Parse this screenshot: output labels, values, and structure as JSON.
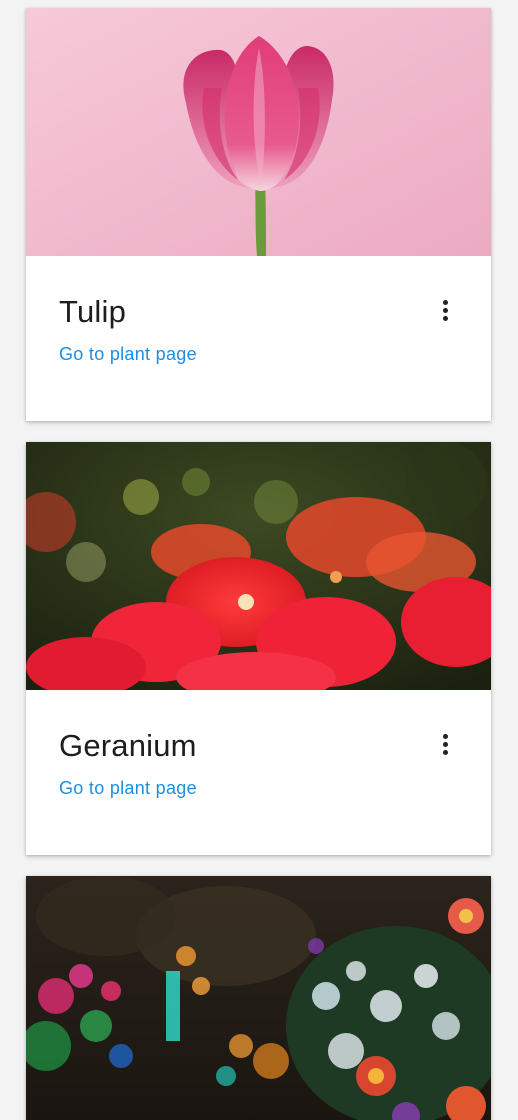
{
  "cards": [
    {
      "title": "Tulip",
      "link_label": "Go to plant page",
      "image_icon": "tulip-photo",
      "menu_icon": "more-vert-icon"
    },
    {
      "title": "Geranium",
      "link_label": "Go to plant page",
      "image_icon": "geranium-photo",
      "menu_icon": "more-vert-icon"
    },
    {
      "image_icon": "garden-flowers-photo"
    }
  ],
  "colors": {
    "link": "#1c8ee3",
    "title": "#1d1d1d",
    "page_background": "#f3f3f3",
    "card_background": "#ffffff"
  }
}
